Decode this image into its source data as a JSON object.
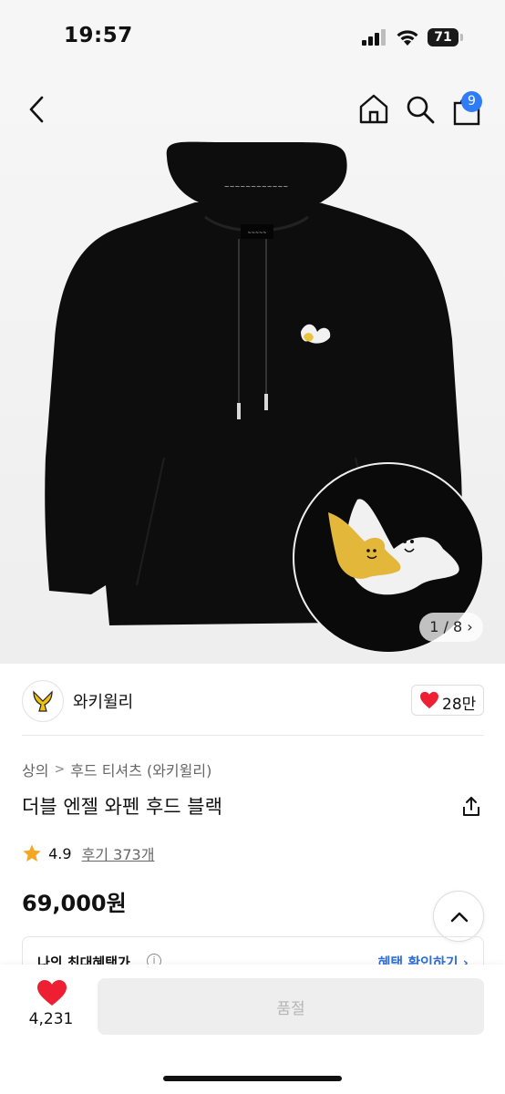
{
  "status_bar": {
    "time": "19:57",
    "battery": "71"
  },
  "nav": {
    "cart_count": "9"
  },
  "image": {
    "page_indicator": "1 / 8"
  },
  "brand": {
    "name": "와키윌리",
    "likes": "28만"
  },
  "breadcrumb": {
    "level1": "상의",
    "level2": "후드 티셔츠 (와키윌리)"
  },
  "product": {
    "title": "더블 엔젤 와펜 후드 블랙",
    "rating": "4.9",
    "reviews": "후기 373개",
    "price": "69,000원"
  },
  "benefit": {
    "label": "나의 최대혜택가",
    "link": "혜택 확인하기 ›"
  },
  "bottom": {
    "wish_count": "4,231",
    "soldout_label": "품절"
  },
  "colors": {
    "accent_red": "#ee1f33",
    "badge_blue": "#2f7cf6",
    "star": "#f5a623",
    "garment": "#0d0d0d"
  }
}
